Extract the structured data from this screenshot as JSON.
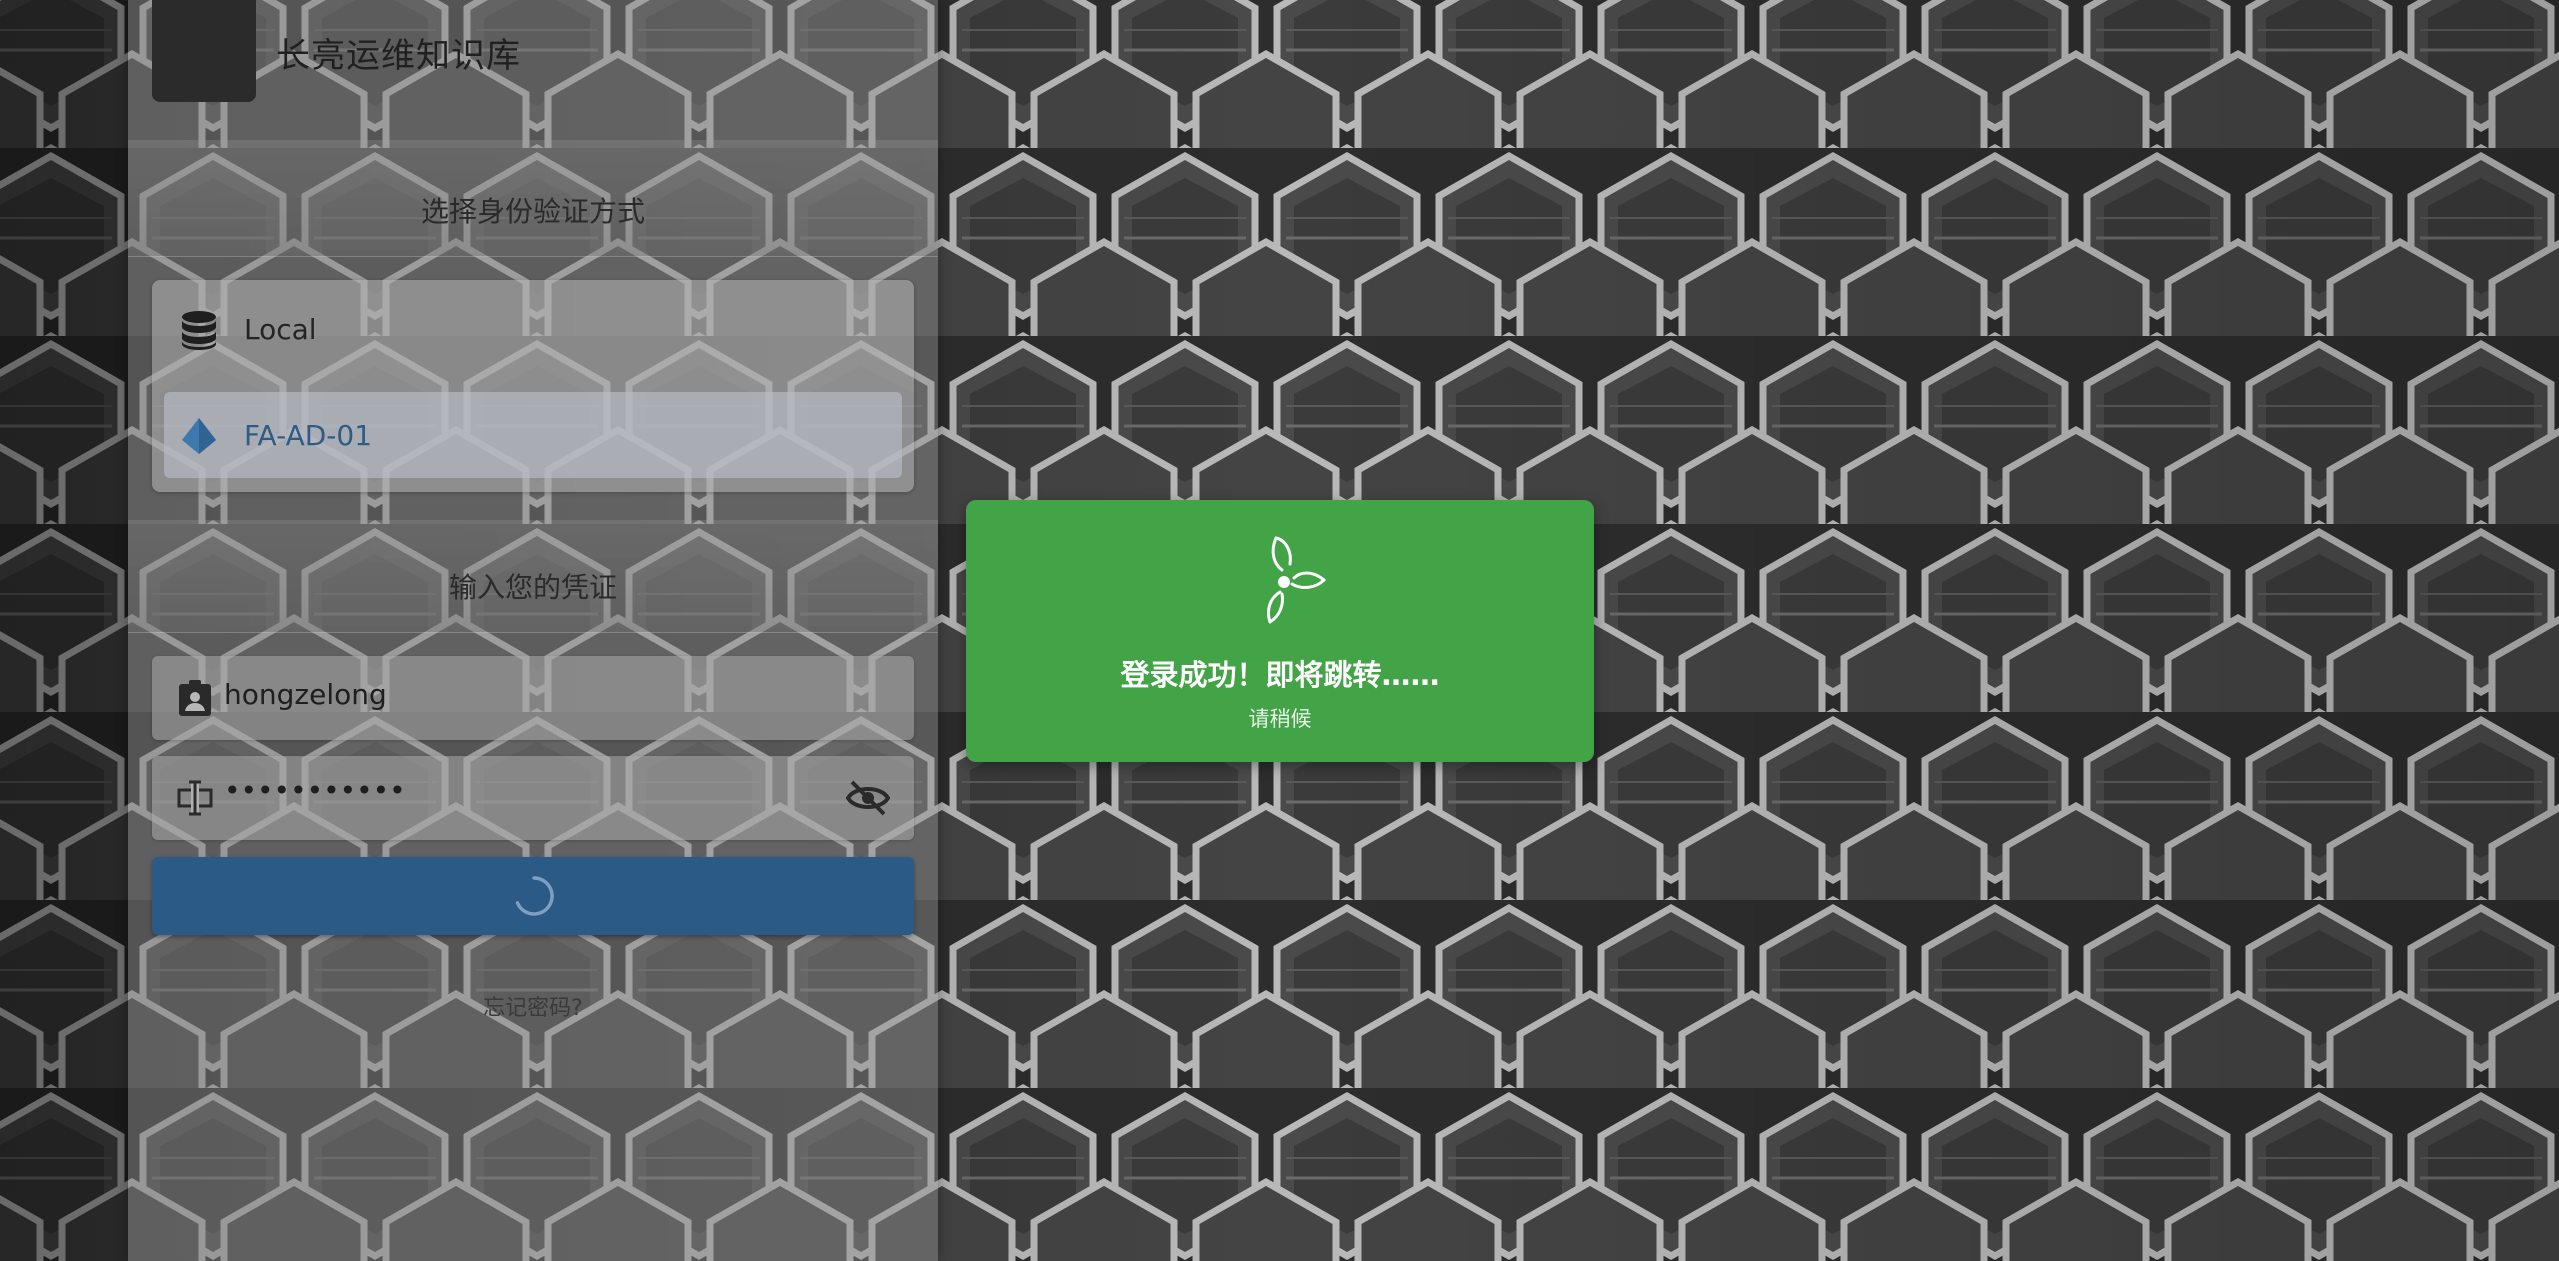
{
  "app": {
    "title": "长亮运维知识库"
  },
  "auth": {
    "heading": "选择身份验证方式",
    "options": [
      {
        "label": "Local",
        "icon": "database-icon",
        "selected": false
      },
      {
        "label": "FA-AD-01",
        "icon": "ad-diamond-icon",
        "selected": true
      }
    ]
  },
  "credentials": {
    "heading": "输入您的凭证",
    "username_value": "hongzelong",
    "password_value": "•••••••••••",
    "submit_state": "loading",
    "forgot_label": "忘记密码?"
  },
  "toast": {
    "title": "登录成功！即将跳转……",
    "subtitle": "请稍候",
    "icon": "loading-tri-icon"
  },
  "colors": {
    "accent": "#2c5a87",
    "selected_text": "#2e5c86",
    "success": "#43a347"
  }
}
